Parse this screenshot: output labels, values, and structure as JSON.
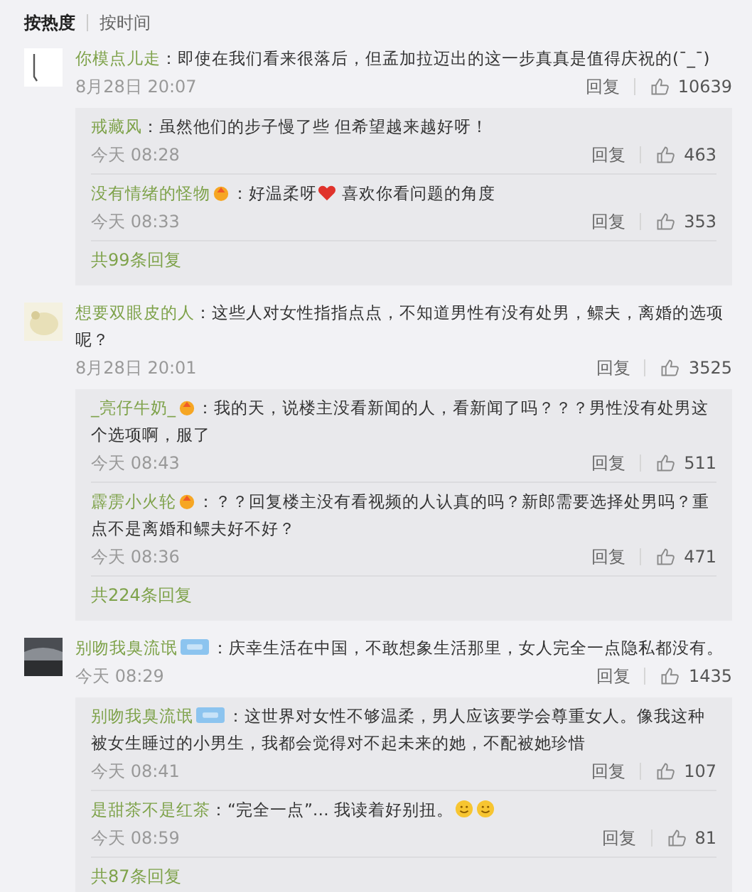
{
  "sort_tabs": [
    {
      "label": "按热度",
      "selected": true
    },
    {
      "label": "按时间",
      "selected": false
    }
  ],
  "comments": [
    {
      "avatar": {
        "kind": "picture"
      },
      "user": "你模点儿走",
      "parts": [
        {
          "kind": "text",
          "text": "：即使在我们看来很落后，但孟加拉迈出的这一步真真是值得庆祝的(¯_¯)"
        }
      ],
      "time": "8月28日 20:07",
      "reply": "回复",
      "likes": "10639",
      "replies": [
        {
          "user": "戒藏风",
          "parts": [
            {
              "kind": "text",
              "text": "：虽然他们的步子慢了些 但希望越来越好呀！"
            }
          ],
          "time": "今天 08:28",
          "reply": "回复",
          "likes": "463"
        },
        {
          "user": "没有情绪的怪物",
          "badge": {
            "kind": "medal"
          },
          "parts": [
            {
              "kind": "text",
              "text": "：好温柔呀"
            },
            {
              "kind": "heart"
            },
            {
              "kind": "text",
              "text": " 喜欢你看问题的角度"
            }
          ],
          "time": "今天 08:33",
          "reply": "回复",
          "likes": "353"
        }
      ],
      "more": "共99条回复"
    },
    {
      "avatar": {
        "kind": "picture"
      },
      "user": "想要双眼皮的人",
      "parts": [
        {
          "kind": "text",
          "text": "：这些人对女性指指点点，不知道男性有没有处男，鳏夫，离婚的选项呢？"
        }
      ],
      "time": "8月28日 20:01",
      "reply": "回复",
      "likes": "3525",
      "replies": [
        {
          "user": "_亮仔牛奶_",
          "badge": {
            "kind": "medal"
          },
          "parts": [
            {
              "kind": "text",
              "text": "：我的天，说楼主没看新闻的人，看新闻了吗？？？男性没有处男这个选项啊，服了"
            }
          ],
          "time": "今天 08:43",
          "reply": "回复",
          "likes": "511"
        },
        {
          "user": "霹雳小火轮",
          "badge": {
            "kind": "medal"
          },
          "parts": [
            {
              "kind": "text",
              "text": "：？？回复楼主没有看视频的人认真的吗？新郎需要选择处男吗？重点不是离婚和鳏夫好不好？"
            }
          ],
          "time": "今天 08:36",
          "reply": "回复",
          "likes": "471"
        }
      ],
      "more": "共224条回复"
    },
    {
      "avatar": {
        "kind": "picture"
      },
      "user": "别吻我臭流氓",
      "badge": {
        "kind": "fan-tag"
      },
      "parts": [
        {
          "kind": "text",
          "text": "：庆幸生活在中国，不敢想象生活那里，女人完全一点隐私都没有。"
        }
      ],
      "time": "今天 08:29",
      "reply": "回复",
      "likes": "1435",
      "replies": [
        {
          "user": "别吻我臭流氓",
          "badge": {
            "kind": "fan-tag"
          },
          "parts": [
            {
              "kind": "text",
              "text": "：这世界对女性不够温柔，男人应该要学会尊重女人。像我这种被女生睡过的小男生，我都会觉得对不起未来的她，不配被她珍惜"
            }
          ],
          "time": "今天 08:41",
          "reply": "回复",
          "likes": "107"
        },
        {
          "user": "是甜茶不是红茶",
          "parts": [
            {
              "kind": "text",
              "text": "：“完全一点”… 我读着好别扭。"
            },
            {
              "kind": "smile"
            },
            {
              "kind": "smile"
            }
          ],
          "time": "今天 08:59",
          "reply": "回复",
          "likes": "81"
        }
      ],
      "more": "共87条回复"
    }
  ]
}
